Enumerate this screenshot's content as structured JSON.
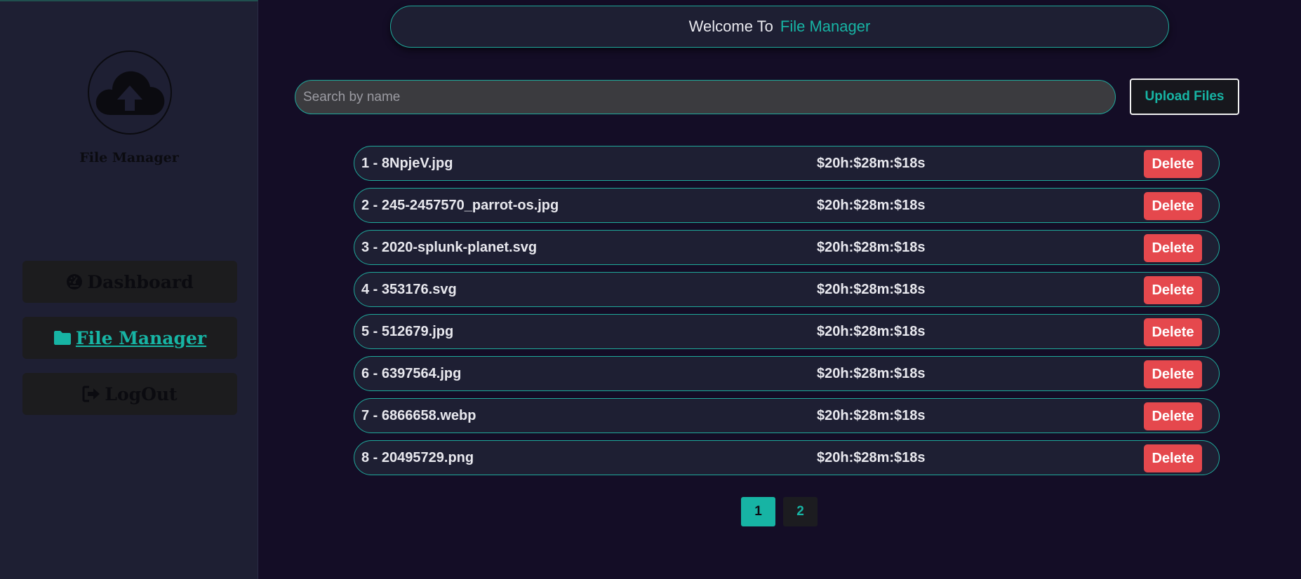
{
  "sidebar": {
    "logo_icon": "cloud-upload-icon",
    "title": "File Manager",
    "nav": [
      {
        "label": "Dashboard",
        "icon": "dashboard-icon",
        "active": false
      },
      {
        "label": "File Manager",
        "icon": "folder-icon",
        "active": true
      },
      {
        "label": "LogOut",
        "icon": "logout-icon",
        "active": false
      }
    ]
  },
  "header": {
    "welcome": "Welcome To",
    "app_name": "File Manager"
  },
  "search": {
    "placeholder": "Search by name",
    "value": ""
  },
  "toolbar": {
    "upload_label": "Upload Files"
  },
  "files": [
    {
      "name": "1 - 8NpjeV.jpg",
      "time": "$20h:$28m:$18s",
      "delete_label": "Delete"
    },
    {
      "name": "2 - 245-2457570_parrot-os.jpg",
      "time": "$20h:$28m:$18s",
      "delete_label": "Delete"
    },
    {
      "name": "3 - 2020-splunk-planet.svg",
      "time": "$20h:$28m:$18s",
      "delete_label": "Delete"
    },
    {
      "name": "4 - 353176.svg",
      "time": "$20h:$28m:$18s",
      "delete_label": "Delete"
    },
    {
      "name": "5 - 512679.jpg",
      "time": "$20h:$28m:$18s",
      "delete_label": "Delete"
    },
    {
      "name": "6 - 6397564.jpg",
      "time": "$20h:$28m:$18s",
      "delete_label": "Delete"
    },
    {
      "name": "7 - 6866658.webp",
      "time": "$20h:$28m:$18s",
      "delete_label": "Delete"
    },
    {
      "name": "8 - 20495729.png",
      "time": "$20h:$28m:$18s",
      "delete_label": "Delete"
    }
  ],
  "pagination": {
    "pages": [
      "1",
      "2"
    ],
    "current": "1"
  },
  "colors": {
    "accent": "#17b4a4",
    "danger": "#e5484d",
    "background": "#140d26",
    "panel": "#1e1f33"
  }
}
